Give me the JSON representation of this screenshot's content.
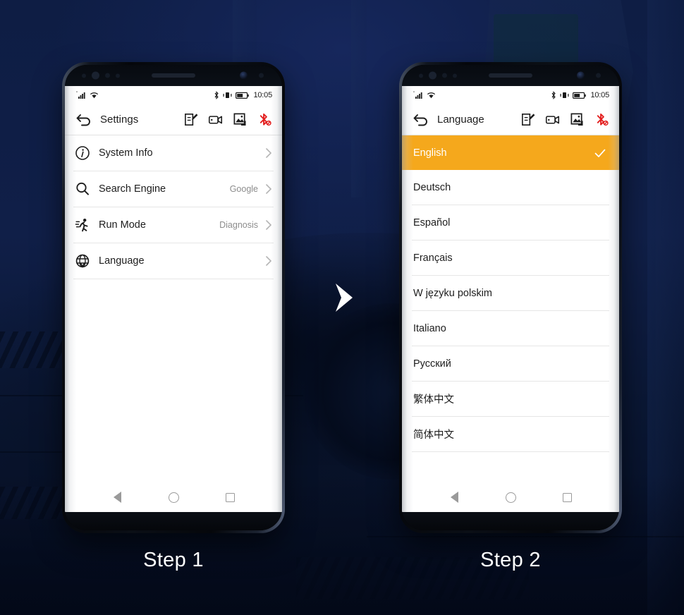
{
  "background": {
    "color": "#0d1b3e",
    "scene": "dark-blue-automotive-garage"
  },
  "arrow": {
    "name": "chevron-right-arrow",
    "color": "#ffffff"
  },
  "steps": [
    {
      "label": "Step 1"
    },
    {
      "label": "Step 2"
    }
  ],
  "phone1": {
    "status_bar": {
      "signal_icon": "signal-bars-icon",
      "wifi_icon": "wifi-icon",
      "bluetooth_icon": "bluetooth-icon",
      "vibrate_icon": "vibrate-icon",
      "battery_icon": "battery-icon",
      "time": "10:05"
    },
    "header": {
      "back_icon": "back-arrow-icon",
      "title": "Settings",
      "icons": [
        {
          "name": "edit-note-icon"
        },
        {
          "name": "video-camera-icon"
        },
        {
          "name": "screenshot-image-icon"
        },
        {
          "name": "bluetooth-disconnected-icon",
          "color": "#e32020"
        }
      ]
    },
    "settings_rows": [
      {
        "icon": "info-circle-icon",
        "label": "System Info",
        "value": ""
      },
      {
        "icon": "search-icon",
        "label": "Search Engine",
        "value": "Google"
      },
      {
        "icon": "running-person-icon",
        "label": "Run Mode",
        "value": "Diagnosis"
      },
      {
        "icon": "globe-icon",
        "label": "Language",
        "value": ""
      }
    ],
    "nav_bar": [
      {
        "name": "nav-back-button"
      },
      {
        "name": "nav-home-button"
      },
      {
        "name": "nav-recents-button"
      }
    ]
  },
  "phone2": {
    "status_bar": {
      "signal_icon": "signal-bars-icon",
      "wifi_icon": "wifi-icon",
      "bluetooth_icon": "bluetooth-icon",
      "vibrate_icon": "vibrate-icon",
      "battery_icon": "battery-icon",
      "time": "10:05"
    },
    "header": {
      "back_icon": "back-arrow-icon",
      "title": "Language",
      "icons": [
        {
          "name": "edit-note-icon"
        },
        {
          "name": "video-camera-icon"
        },
        {
          "name": "screenshot-image-icon"
        },
        {
          "name": "bluetooth-disconnected-icon",
          "color": "#e32020"
        }
      ]
    },
    "selected_highlight_color": "#f5a81c",
    "languages": [
      {
        "name": "English",
        "selected": true
      },
      {
        "name": "Deutsch",
        "selected": false
      },
      {
        "name": "Español",
        "selected": false
      },
      {
        "name": "Français",
        "selected": false
      },
      {
        "name": "W języku polskim",
        "selected": false
      },
      {
        "name": "Italiano",
        "selected": false
      },
      {
        "name": "Русский",
        "selected": false
      },
      {
        "name": "繁体中文",
        "selected": false
      },
      {
        "name": "简体中文",
        "selected": false
      }
    ],
    "nav_bar": [
      {
        "name": "nav-back-button"
      },
      {
        "name": "nav-home-button"
      },
      {
        "name": "nav-recents-button"
      }
    ]
  }
}
